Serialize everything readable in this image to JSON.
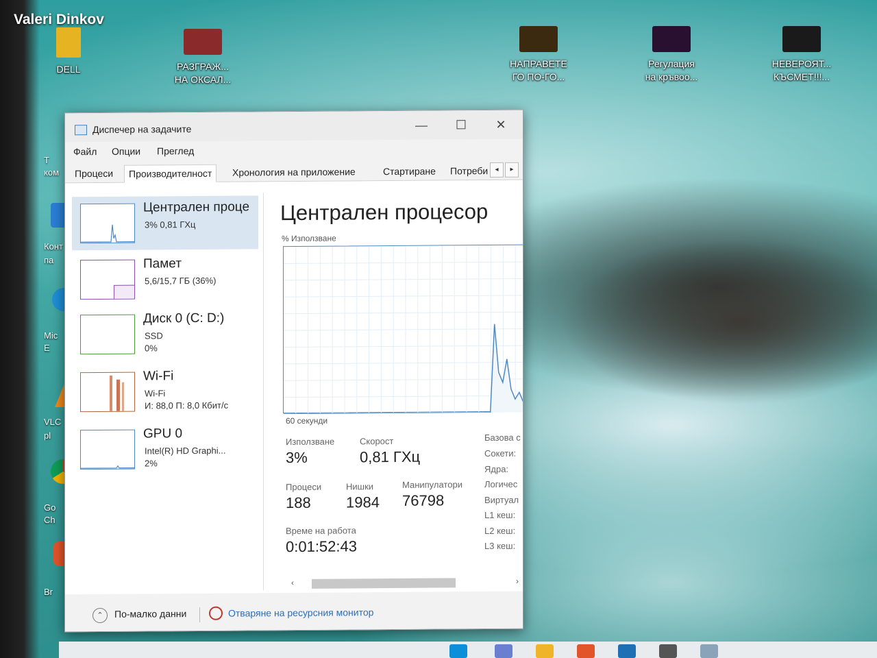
{
  "watermark": "Valeri Dinkov",
  "desktop_icons": [
    {
      "label": "DELL",
      "color": "#e6b422"
    },
    {
      "label": "РАЗГРАЖ...\nНА ОКСАЛ...",
      "color": "#8a2a2a"
    },
    {
      "label": "НАПРАВЕТЕ\nГО ПО-ГО...",
      "color": "#3b2a10"
    },
    {
      "label": "Регулация\nна кръвоо...",
      "color": "#2a1030"
    },
    {
      "label": "НЕВЕРОЯТ...\nКЪСМЕТ!!!...",
      "color": "#1a1a1a"
    }
  ],
  "side_labels": [
    "Т",
    "ком",
    "Конт",
    "па",
    "Mic",
    "E",
    "VLC",
    "pl",
    "Go",
    "Ch",
    "Br"
  ],
  "window": {
    "title": "Диспечер на задачите",
    "controls": {
      "minimize": "—",
      "maximize": "☐",
      "close": "✕"
    },
    "menu": [
      "Файл",
      "Опции",
      "Преглед"
    ],
    "tabs": [
      "Процеси",
      "Производителност",
      "Хронология на приложение",
      "Стартиране",
      "Потреби"
    ],
    "active_tab": "Производителност",
    "tab_scroll": {
      "left": "◂",
      "right": "▸"
    }
  },
  "resources": [
    {
      "name": "Централен проце",
      "line1": "3% 0,81 ГХц",
      "line2": "",
      "color": "#4f89c4",
      "selected": true
    },
    {
      "name": "Памет",
      "line1": "5,6/15,7 ГБ (36%)",
      "line2": "",
      "color": "#8b4fb0",
      "selected": false
    },
    {
      "name": "Диск 0 (C: D:)",
      "line1": "SSD",
      "line2": "0%",
      "color": "#4f9a3a",
      "selected": false
    },
    {
      "name": "Wi-Fi",
      "line1": "Wi-Fi",
      "line2": "И: 88,0 П: 8,0 Кбит/с",
      "color": "#b5663a",
      "selected": false
    },
    {
      "name": "GPU 0",
      "line1": "Intel(R) HD Graphi...",
      "line2": "2%",
      "color": "#4f89c4",
      "selected": false
    }
  ],
  "cpu": {
    "title": "Централен процесор",
    "usage_axis_label": "% Използване",
    "time_label": "60 секунди",
    "stats": {
      "usage_label": "Използване",
      "usage_value": "3%",
      "speed_label": "Скорост",
      "speed_value": "0,81 ГХц",
      "processes_label": "Процеси",
      "processes_value": "188",
      "threads_label": "Нишки",
      "threads_value": "1984",
      "handles_label": "Манипулатори",
      "handles_value": "76798",
      "uptime_label": "Време на работа",
      "uptime_value": "0:01:52:43"
    },
    "spec_labels": [
      "Базова с",
      "Сокети:",
      "Ядра:",
      "Логичес",
      "Виртуал",
      "L1 кеш:",
      "L2 кеш:",
      "L3 кеш:"
    ],
    "usage_history": [
      0,
      0,
      0,
      0,
      0,
      0,
      0,
      0,
      0,
      0,
      0,
      0,
      0,
      0,
      0,
      0,
      0,
      0,
      0,
      0,
      0,
      0,
      0,
      0,
      0,
      0,
      0,
      0,
      0,
      0,
      0,
      0,
      0,
      0,
      0,
      0,
      0,
      0,
      0,
      0,
      0,
      0,
      0,
      0,
      0,
      0,
      0,
      0,
      0,
      0,
      0,
      53,
      24,
      18,
      32,
      14,
      8,
      12,
      6,
      10
    ]
  },
  "footer": {
    "fewer_details_icon": "chevron-up-icon",
    "fewer_details": "По-малко данни",
    "resource_monitor": "Отваряне на ресурсния монитор"
  },
  "colors": {
    "cpu_graph": "#4f89c4",
    "link": "#2a6ebb",
    "selected_item": "#d9e6f2"
  }
}
